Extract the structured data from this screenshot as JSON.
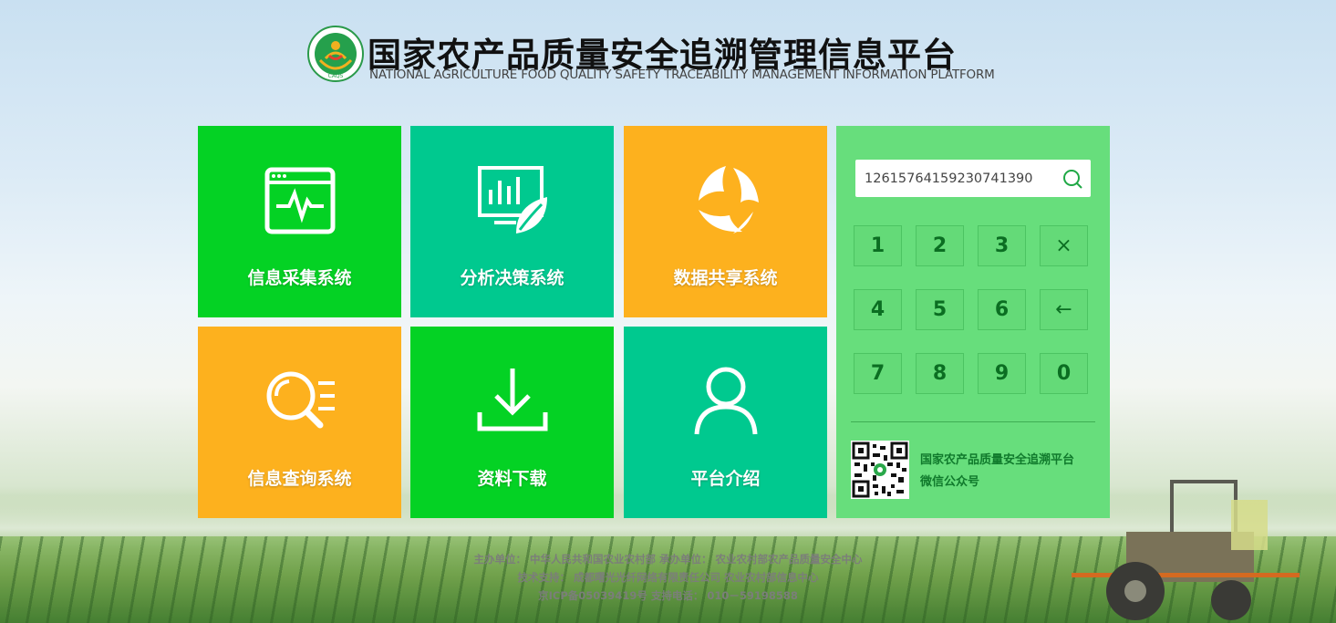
{
  "header": {
    "title_cn": "国家农产品质量安全追溯管理信息平台",
    "title_en": "NATIONAL AGRICULTURE  FOOD QUALITY SAFETY TRACEABILITY MANAGEMENT INFORMATION PLATFORM",
    "logo_text": "CAQS"
  },
  "tiles": [
    {
      "label": "信息采集系统",
      "icon": "monitor-pulse-icon",
      "color": "#04d224"
    },
    {
      "label": "分析决策系统",
      "icon": "chart-leaf-icon",
      "color": "#00c98f"
    },
    {
      "label": "数据共享系统",
      "icon": "recycle-leaf-icon",
      "color": "#fdb11e"
    },
    {
      "label": "信息查询系统",
      "icon": "search-list-icon",
      "color": "#fdb11e"
    },
    {
      "label": "资料下载",
      "icon": "download-icon",
      "color": "#04d224"
    },
    {
      "label": "平台介绍",
      "icon": "user-icon",
      "color": "#00c98f"
    }
  ],
  "search": {
    "value": "12615764159230741390",
    "icon": "search-icon"
  },
  "keypad": {
    "keys": [
      "1",
      "2",
      "3",
      "×",
      "4",
      "5",
      "6",
      "←",
      "7",
      "8",
      "9",
      "0"
    ]
  },
  "wechat": {
    "line1": "国家农产品质量安全追溯平台",
    "line2": "微信公众号"
  },
  "footer": {
    "line1": "主办单位： 中华人民共和国农业农村部   承办单位： 农业农村部农产品质量安全中心",
    "line2": "技术支持： 成都曙光光纤网络有限责任公司    农业农村部信息中心",
    "line3": "京ICP备05039419号   支持电话： 010－59198588"
  },
  "colors": {
    "green": "#04d224",
    "teal": "#00c98f",
    "orange": "#fdb11e",
    "panel": "#67de7c"
  }
}
